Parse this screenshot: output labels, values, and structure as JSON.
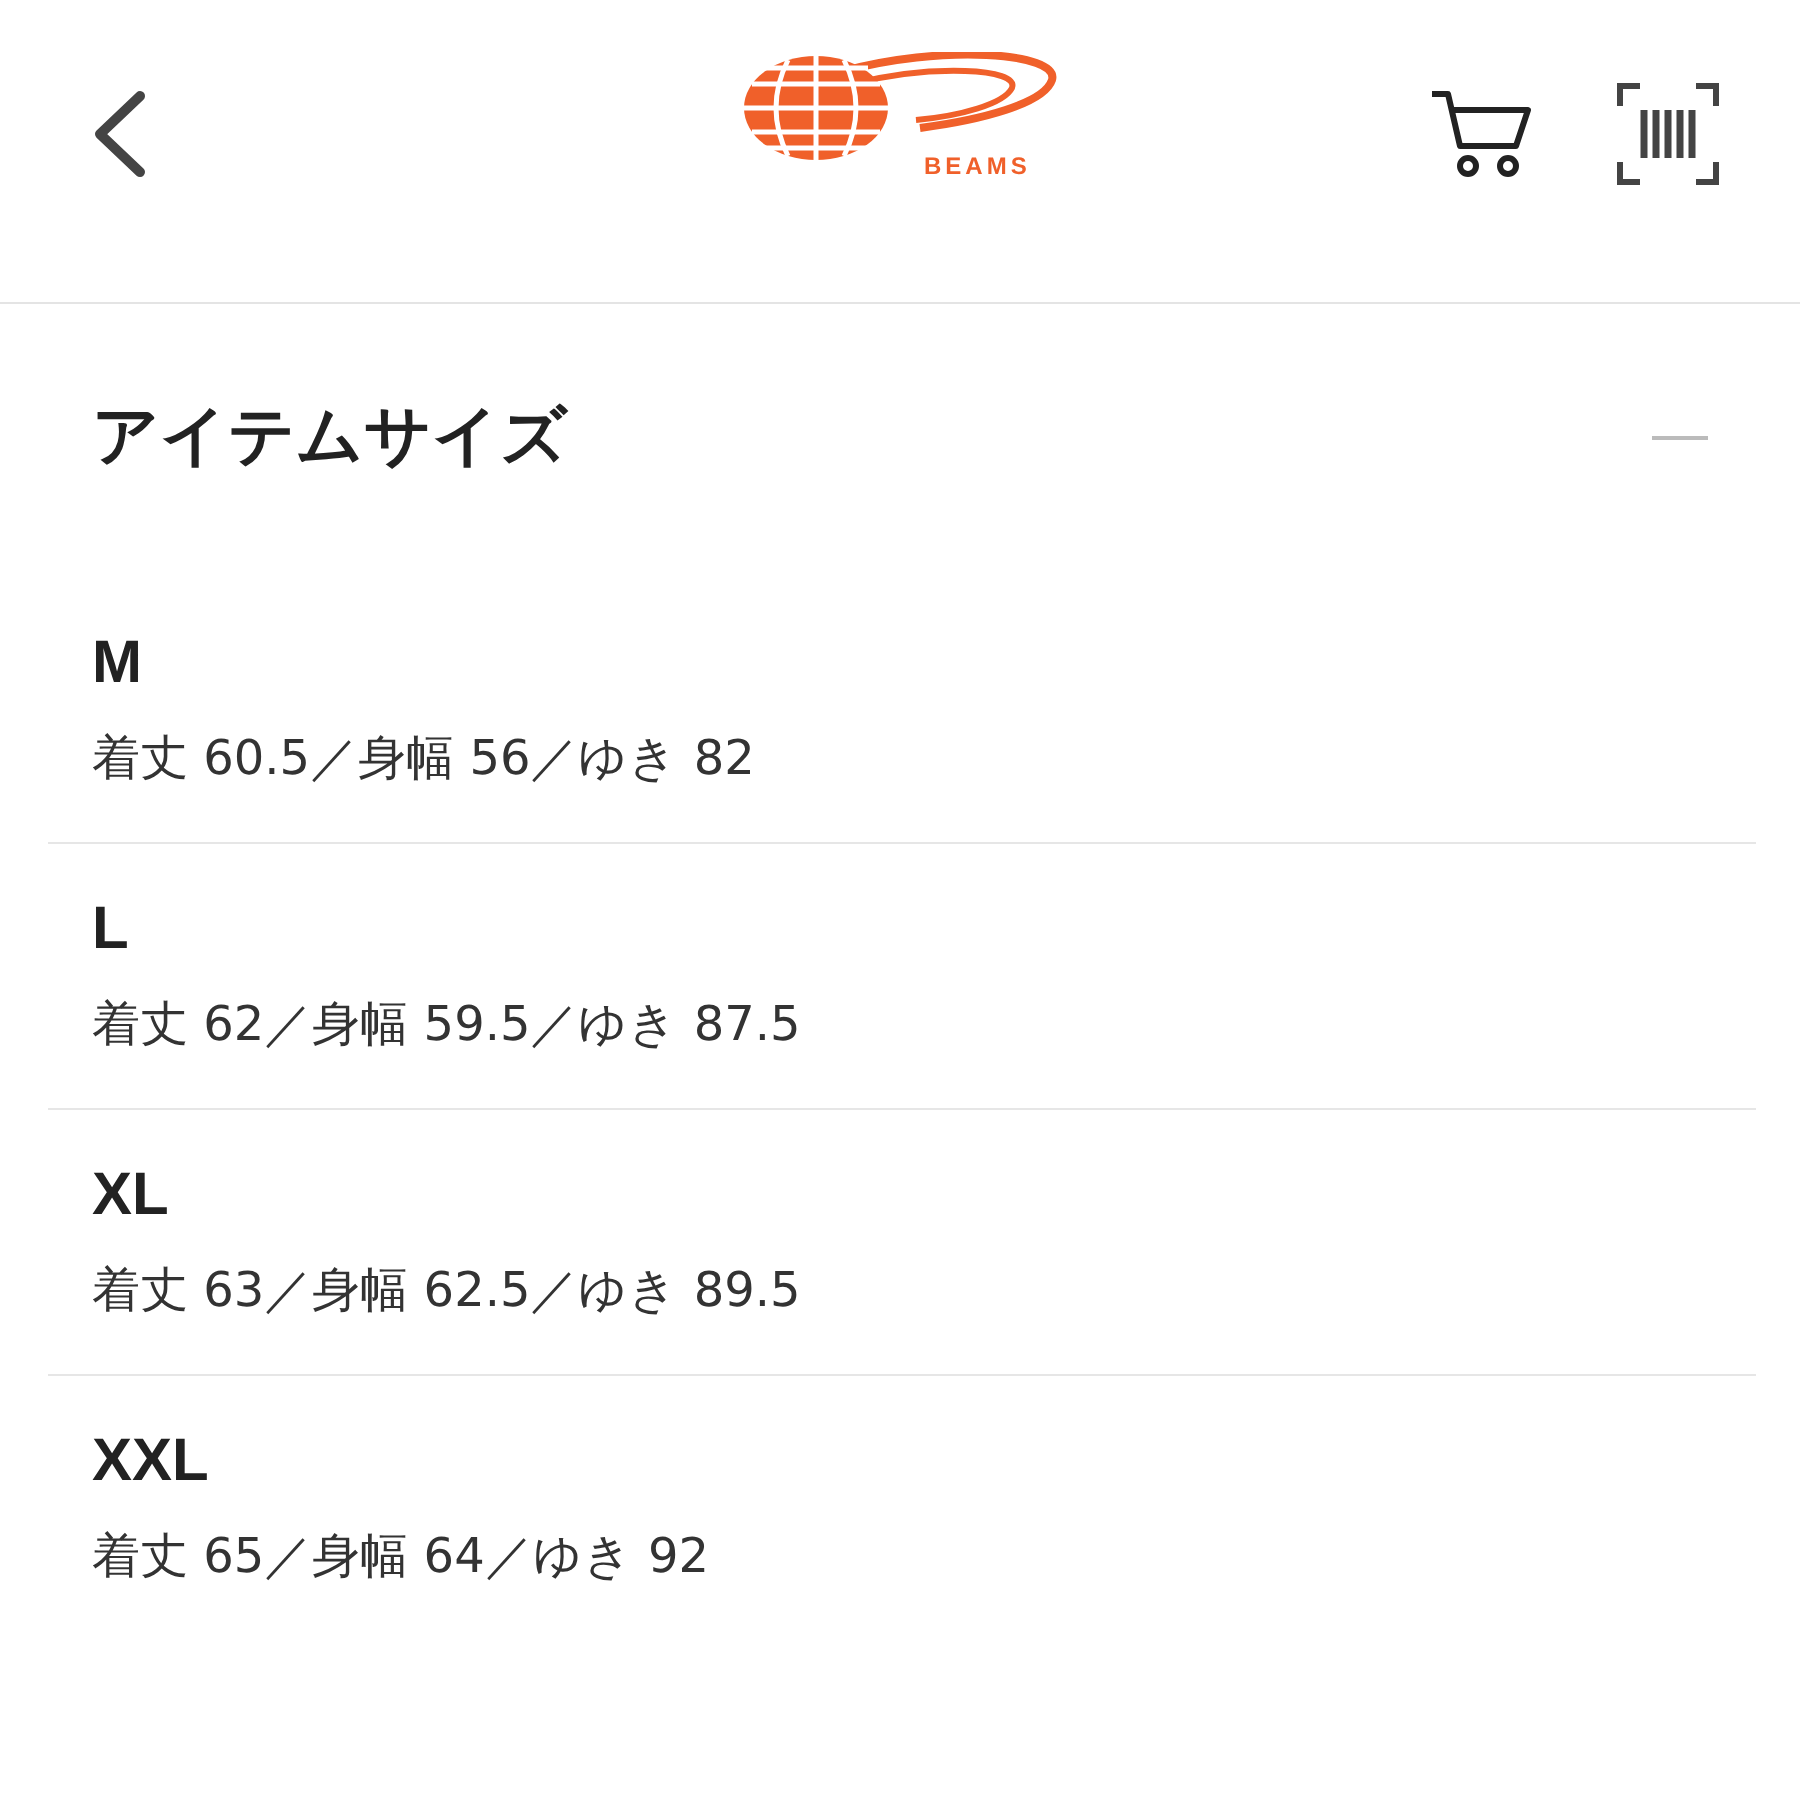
{
  "header": {
    "logo_text": "BEAMS"
  },
  "section": {
    "title": "アイテムサイズ",
    "expanded": true,
    "sizes": [
      {
        "size": "M",
        "measurements": "着丈 60.5／身幅 56／ゆき 82"
      },
      {
        "size": "L",
        "measurements": "着丈 62／身幅 59.5／ゆき 87.5"
      },
      {
        "size": "XL",
        "measurements": "着丈 63／身幅 62.5／ゆき 89.5"
      },
      {
        "size": "XXL",
        "measurements": "着丈 65／身幅 64／ゆき 92"
      }
    ]
  }
}
